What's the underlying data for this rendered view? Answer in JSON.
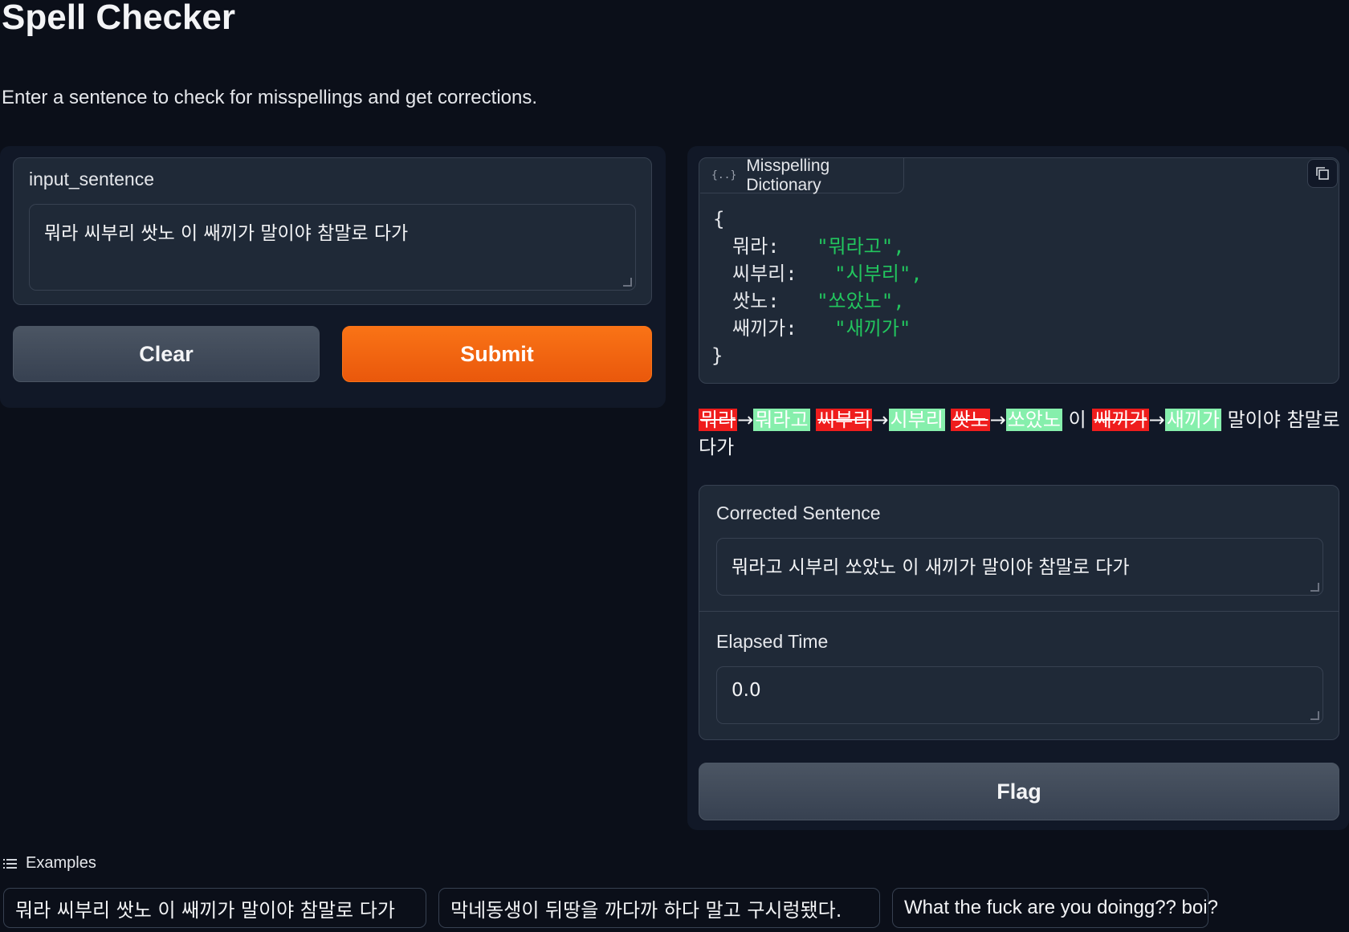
{
  "header": {
    "title": "Spell Checker",
    "description": "Enter a sentence to check for misspellings and get corrections."
  },
  "input": {
    "label": "input_sentence",
    "value": "뭐라 씨부리 쌋노 이 쌔끼가 말이야 참말로 다가"
  },
  "buttons": {
    "clear": "Clear",
    "submit": "Submit",
    "flag": "Flag"
  },
  "dictionary": {
    "label": "Misspelling Dictionary",
    "icon": "json-braces-icon",
    "open_brace": "{",
    "close_brace": "}",
    "entries": [
      {
        "key": "뭐라:",
        "value": "\"뭐라고\","
      },
      {
        "key": "씨부리:",
        "value": "\"시부리\","
      },
      {
        "key": "쌋노:",
        "value": "\"쏘았노\","
      },
      {
        "key": "쌔끼가:",
        "value": "\"새끼가\""
      }
    ]
  },
  "highlight": {
    "arrow": "→",
    "segments": [
      {
        "wrong": "뭐라",
        "right": "뭐라고"
      },
      {
        "wrong": "씨부리",
        "right": "시부리"
      },
      {
        "wrong": "쌋노",
        "right": "쏘았노"
      },
      {
        "plain": "이"
      },
      {
        "wrong": "쌔끼가",
        "right": "새끼가"
      },
      {
        "plain": "말이야 참말로 다가"
      }
    ]
  },
  "output": {
    "corrected_label": "Corrected Sentence",
    "corrected_value": "뭐라고 시부리 쏘았노 이 새끼가 말이야 참말로 다가",
    "elapsed_label": "Elapsed Time",
    "elapsed_value": "0.0"
  },
  "examples": {
    "label": "Examples",
    "items": [
      "뭐라 씨부리 쌋노 이 쌔끼가 말이야 참말로 다가",
      "막네동생이 뒤땅을 까다까 하다 말고 구시렁됐다.",
      "What the fuck are you doingg?? boi?"
    ]
  },
  "colors": {
    "background": "#0b0f19",
    "panel": "#111827",
    "primary": "#f97316",
    "json_string": "#22c55e",
    "deletion": "#ef1d1d",
    "insertion": "#86efac"
  }
}
